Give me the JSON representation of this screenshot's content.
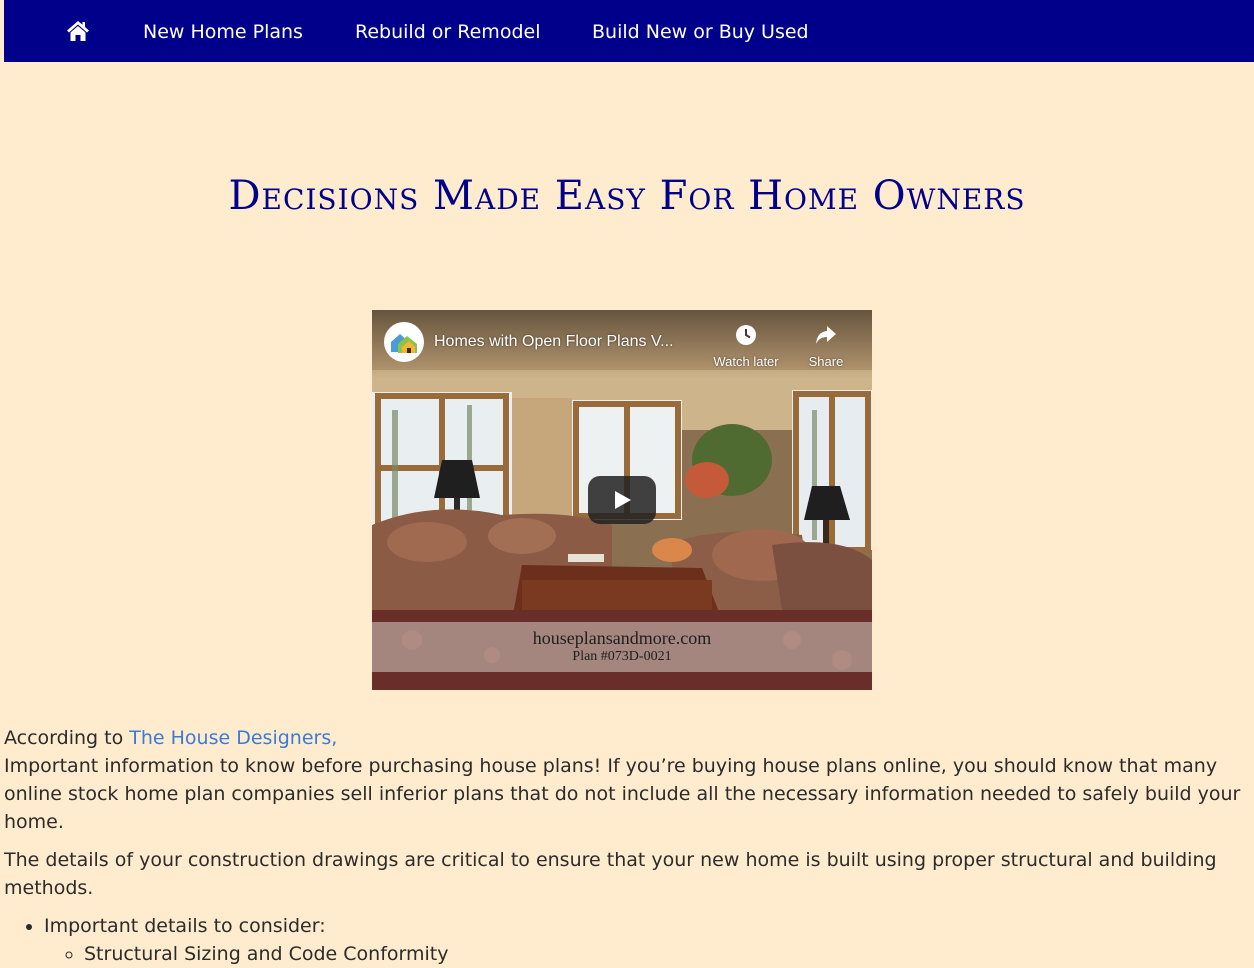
{
  "nav": {
    "home_icon": "home-icon",
    "links": [
      "New Home Plans",
      "Rebuild or Remodel",
      "Build New or Buy Used"
    ],
    "background": "#00008b"
  },
  "title": "Decisions Made Easy For Home Owners",
  "video": {
    "title": "Homes with Open Floor Plans V...",
    "watch_later": "Watch later",
    "share": "Share",
    "caption_line1": "houseplansandmore.com",
    "caption_line2": "Plan #073D-0021",
    "icons": [
      "channel-logo-icon",
      "clock-icon",
      "share-arrow-icon",
      "play-icon"
    ]
  },
  "content": {
    "intro_prefix": "According to ",
    "intro_link": "The House Designers,",
    "para1": "Important information to know before purchasing house plans! If you’re buying house plans online, you should know that many online stock home plan companies sell inferior plans that do not include all the necessary information needed to safely build your home.",
    "para2": "The details of your construction drawings are critical to ensure that your new home is built using proper structural and building methods.",
    "list_heading": "Important details to consider:",
    "sub_items": [
      "Structural Sizing and Code Conformity"
    ],
    "link_color": "#3a7bd5"
  }
}
